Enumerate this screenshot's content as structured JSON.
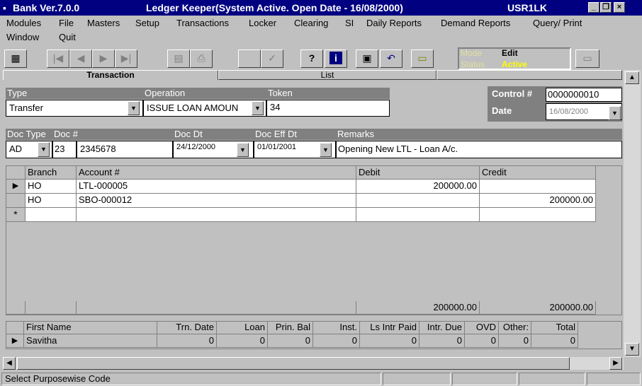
{
  "window": {
    "app_name": "Bank Ver.7.0.0",
    "title": "Ledger Keeper(System Active. Open Date - 16/08/2000)",
    "user": "USR1LK"
  },
  "menu": [
    "Modules",
    "File",
    "Masters",
    "Setup",
    "Transactions",
    "Locker",
    "Clearing",
    "SI",
    "Daily Reports",
    "Demand Reports",
    "Query/ Print",
    "Window",
    "Quit"
  ],
  "mode_panel": {
    "mode_label": "Mode",
    "mode_value": "Edit",
    "status_label": "Status",
    "status_value": "Active"
  },
  "tabs": {
    "transaction": "Transaction",
    "list": "List"
  },
  "form": {
    "type_label": "Type",
    "type_value": "Transfer",
    "operation_label": "Operation",
    "operation_value": "ISSUE LOAN AMOUN",
    "token_label": "Token",
    "token_value": "34",
    "control_label": "Control #",
    "control_value": "0000000010",
    "date_label": "Date",
    "date_value": "16/08/2000",
    "doctype_label": "Doc Type",
    "doctype_value": "AD",
    "docno_label": "Doc #",
    "docno_prefix": "23",
    "docno_value": "2345678",
    "docdt_label": "Doc Dt",
    "docdt_value": "24/12/2000",
    "doceffdt_label": "Doc Eff Dt",
    "doceffdt_value": "01/01/2001",
    "remarks_label": "Remarks",
    "remarks_value": "Opening New LTL - Loan  A/c."
  },
  "entries": {
    "headers": {
      "branch": "Branch",
      "account": "Account #",
      "debit": "Debit",
      "credit": "Credit"
    },
    "rows": [
      {
        "branch": "HO",
        "account": "LTL-000005",
        "debit": "200000.00",
        "credit": ""
      },
      {
        "branch": "HO",
        "account": "SBO-000012",
        "debit": "",
        "credit": "200000.00"
      }
    ],
    "new_row_marker": "*",
    "totals": {
      "debit": "200000.00",
      "credit": "200000.00"
    }
  },
  "summary": {
    "headers": {
      "first_name": "First Name",
      "trn_date": "Trn. Date",
      "loan": "Loan",
      "prin_bal": "Prin. Bal",
      "inst": "Inst.",
      "ls_intr_paid": "Ls Intr Paid",
      "intr_due": "Intr. Due",
      "ovd": "OVD",
      "other": "Other:",
      "total": "Total"
    },
    "row": {
      "first_name": "Savitha",
      "trn_date": "0",
      "loan": "0",
      "prin_bal": "0",
      "inst": "0",
      "ls_intr_paid": "0",
      "intr_due": "0",
      "ovd": "0",
      "other": "0",
      "total": "0"
    }
  },
  "statusbar": {
    "message": "Select Purposewise Code"
  },
  "icons": {
    "app": "bank-app-icon",
    "toolbar": [
      "new-record-icon",
      "first-record-icon",
      "previous-record-icon",
      "next-record-icon",
      "last-record-icon",
      "find-icon",
      "print-icon",
      "blank-icon",
      "check-icon",
      "help-icon",
      "info-icon",
      "save-icon",
      "undo-icon",
      "open-folder-icon",
      "folder-icon"
    ]
  },
  "colors": {
    "titlebar": "#000080",
    "status_active": "#ffff00",
    "header_gray": "#808080",
    "window": "#c0c0c0"
  }
}
